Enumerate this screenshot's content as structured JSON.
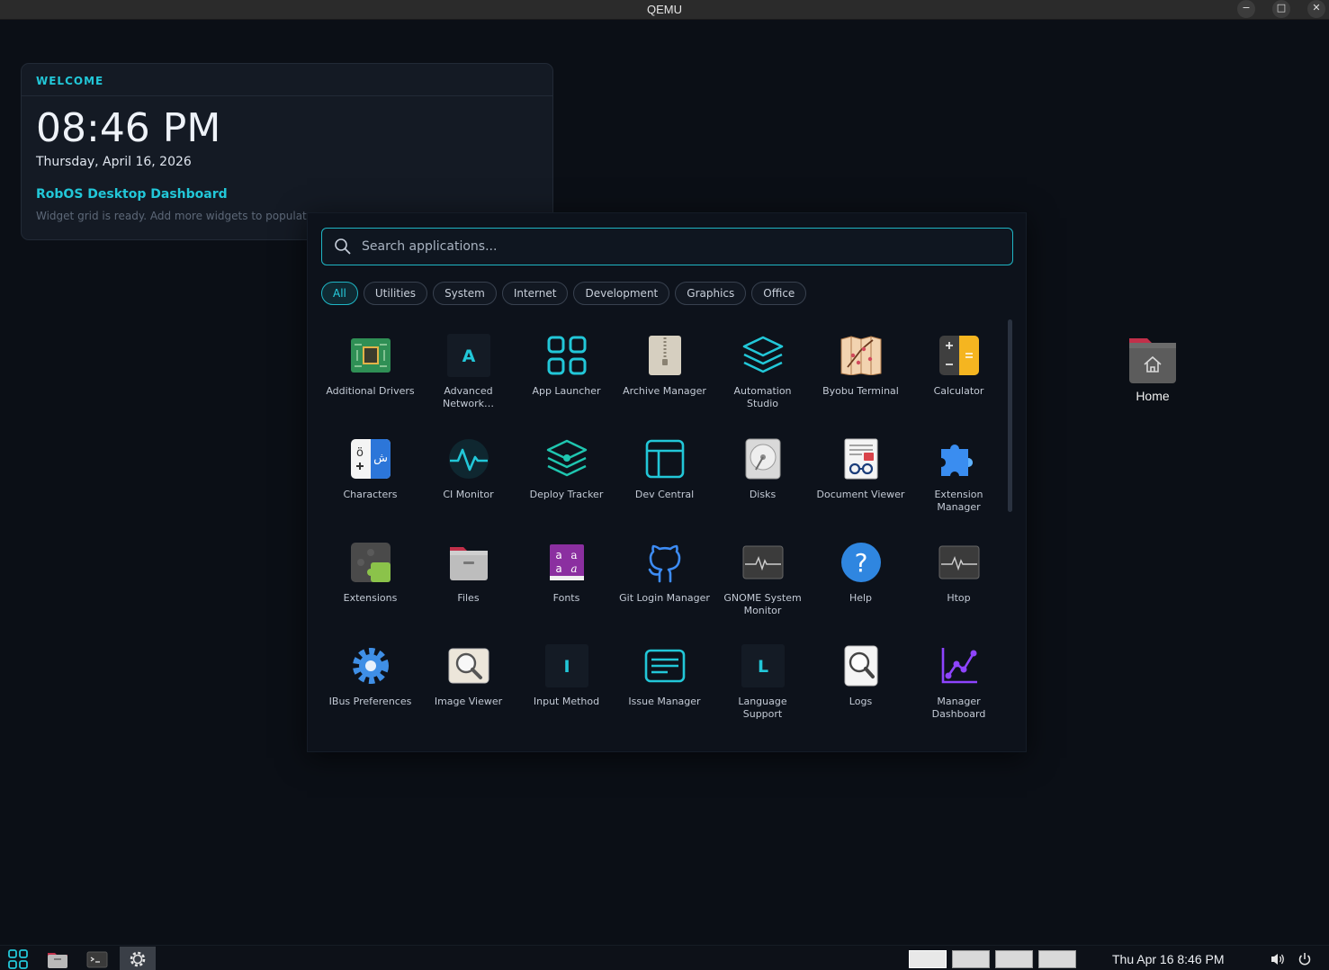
{
  "window": {
    "title": "QEMU",
    "minimize": "−",
    "maximize": "□",
    "close": "✕"
  },
  "widget": {
    "header": "WELCOME",
    "time": "08:46 PM",
    "date": "Thursday, April 16, 2026",
    "dashboard_title": "RobOS Desktop Dashboard",
    "dashboard_sub": "Widget grid is ready. Add more widgets to populat"
  },
  "desktop": {
    "home_label": "Home"
  },
  "launcher": {
    "search_placeholder": "Search applications...",
    "categories": [
      "All",
      "Utilities",
      "System",
      "Internet",
      "Development",
      "Graphics",
      "Office"
    ],
    "active_category": "All",
    "apps": [
      {
        "name": "Additional Drivers",
        "icon": "chip-icon"
      },
      {
        "name": "Advanced Network…",
        "icon": "letter-a-icon",
        "letter": "A"
      },
      {
        "name": "App Launcher",
        "icon": "grid-icon"
      },
      {
        "name": "Archive Manager",
        "icon": "archive-icon"
      },
      {
        "name": "Automation Studio",
        "icon": "layers-icon"
      },
      {
        "name": "Byobu Terminal",
        "icon": "byobu-icon"
      },
      {
        "name": "Calculator",
        "icon": "calculator-icon"
      },
      {
        "name": "Characters",
        "icon": "characters-icon"
      },
      {
        "name": "CI Monitor",
        "icon": "pulse-icon"
      },
      {
        "name": "Deploy Tracker",
        "icon": "deploy-icon"
      },
      {
        "name": "Dev Central",
        "icon": "window-icon"
      },
      {
        "name": "Disks",
        "icon": "disk-icon"
      },
      {
        "name": "Document Viewer",
        "icon": "document-icon"
      },
      {
        "name": "Extension Manager",
        "icon": "puzzle-icon"
      },
      {
        "name": "Extensions",
        "icon": "extensions-icon"
      },
      {
        "name": "Files",
        "icon": "folder-icon"
      },
      {
        "name": "Fonts",
        "icon": "fonts-icon"
      },
      {
        "name": "Git Login Manager",
        "icon": "github-icon"
      },
      {
        "name": "GNOME System Monitor",
        "icon": "system-monitor-icon"
      },
      {
        "name": "Help",
        "icon": "help-icon"
      },
      {
        "name": "Htop",
        "icon": "htop-icon"
      },
      {
        "name": "IBus Preferences",
        "icon": "gear-icon"
      },
      {
        "name": "Image Viewer",
        "icon": "image-viewer-icon"
      },
      {
        "name": "Input Method",
        "icon": "letter-i-icon",
        "letter": "I"
      },
      {
        "name": "Issue Manager",
        "icon": "issue-icon"
      },
      {
        "name": "Language Support",
        "icon": "letter-l-icon",
        "letter": "L"
      },
      {
        "name": "Logs",
        "icon": "logs-icon"
      },
      {
        "name": "Manager Dashboard",
        "icon": "chart-icon"
      }
    ]
  },
  "taskbar": {
    "clock": "Thu Apr 16   8:46 PM",
    "workspaces": 4
  },
  "colors": {
    "accent": "#22c7d8",
    "background": "#0b0f16",
    "panel": "#0d121b"
  }
}
